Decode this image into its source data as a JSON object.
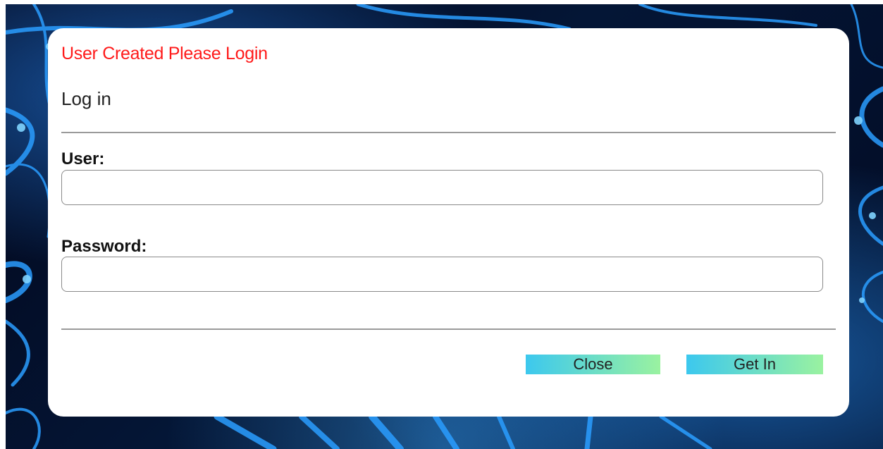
{
  "modal": {
    "alert_message": "User Created Please Login",
    "title": "Log in",
    "fields": {
      "user": {
        "label": "User:",
        "value": "",
        "placeholder": ""
      },
      "password": {
        "label": "Password:",
        "value": "",
        "placeholder": ""
      }
    },
    "buttons": {
      "close_label": "Close",
      "get_in_label": "Get In"
    }
  },
  "colors": {
    "alert_text": "#ff1a1a",
    "button_gradient_start": "#3cc8ee",
    "button_gradient_end": "#9af2a0",
    "background_dark": "#041636",
    "background_glow": "#2a8cff"
  }
}
